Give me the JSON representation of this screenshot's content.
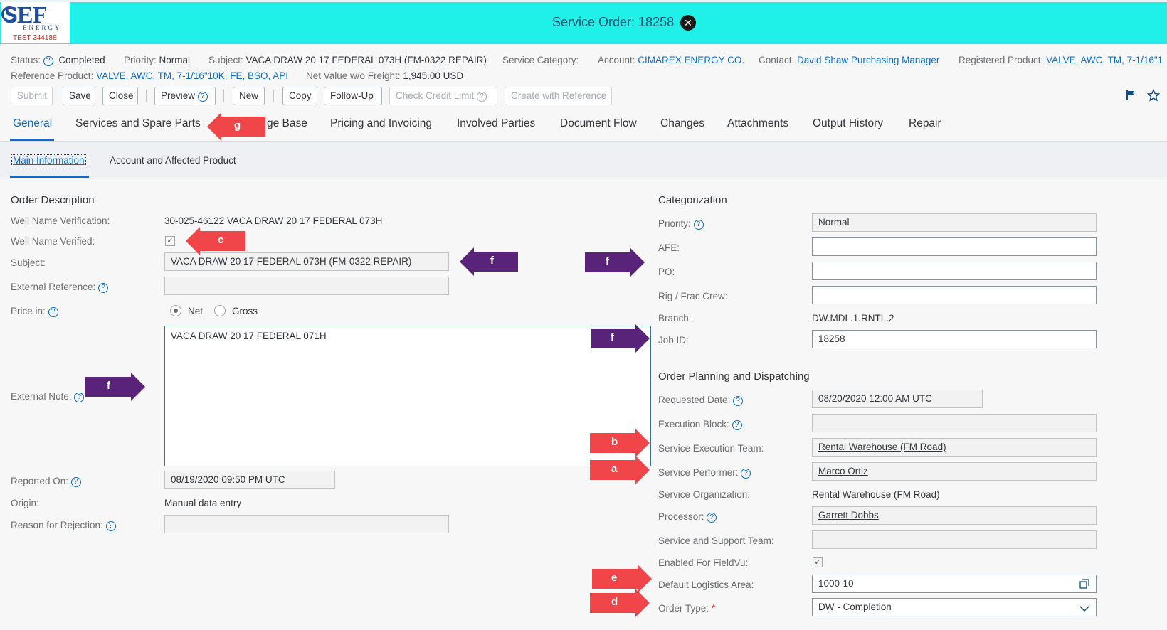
{
  "header": {
    "title": "Service Order: 18258",
    "logo": {
      "main": "SEF",
      "sub": "ENERGY",
      "test": "TEST 344188"
    }
  },
  "info": {
    "status_label": "Status:",
    "status_value": "Completed",
    "priority_label": "Priority:",
    "priority_value": "Normal",
    "subject_label": "Subject:",
    "subject_value": "VACA DRAW 20 17 FEDERAL 073H (FM-0322 REPAIR)",
    "service_category_label": "Service Category:",
    "account_label": "Account:",
    "account_value": "CIMAREX ENERGY CO.",
    "contact_label": "Contact:",
    "contact_value": "David Shaw Purchasing Manager",
    "registered_label": "Registered Product:",
    "registered_value": "VALVE, AWC, TM, 7-1/16\"1",
    "reference_label": "Reference Product:",
    "reference_value": "VALVE, AWC, TM, 7-1/16\"10K, FE, BSO, API",
    "net_label": "Net Value w/o Freight:",
    "net_value": "1,945.00 USD"
  },
  "toolbar": {
    "submit": "Submit",
    "save": "Save",
    "close": "Close",
    "preview": "Preview",
    "new": "New",
    "copy": "Copy",
    "follow_up": "Follow-Up",
    "check_credit": "Check Credit Limit",
    "create_ref": "Create with Reference"
  },
  "tabs": {
    "general": "General",
    "services": "Services and Spare Parts",
    "knowledge": "ge Base",
    "pricing": "Pricing and Invoicing",
    "parties": "Involved Parties",
    "docflow": "Document Flow",
    "changes": "Changes",
    "attachments": "Attachments",
    "output": "Output History",
    "repair": "Repair"
  },
  "subtabs": {
    "main": "Main Information",
    "account": "Account and Affected Product"
  },
  "left": {
    "section": "Order Description",
    "well_verification_label": "Well Name Verification:",
    "well_verification_value": "30-025-46122 VACA DRAW 20 17 FEDERAL 073H",
    "well_verified_label": "Well Name Verified:",
    "subject_label": "Subject:",
    "subject_value": "VACA DRAW 20 17 FEDERAL 073H (FM-0322 REPAIR)",
    "external_ref_label": "External Reference:",
    "price_in_label": "Price in:",
    "net": "Net",
    "gross": "Gross",
    "external_note_label": "External Note:",
    "external_note_value": "VACA DRAW 20 17 FEDERAL 071H",
    "reported_on_label": "Reported On:",
    "reported_on_value": "08/19/2020 09:50 PM UTC",
    "origin_label": "Origin:",
    "origin_value": "Manual data entry",
    "rejection_label": "Reason for Rejection:"
  },
  "right": {
    "categorization": "Categorization",
    "priority_label": "Priority:",
    "priority_value": "Normal",
    "afe_label": "AFE:",
    "po_label": "PO:",
    "rig_label": "Rig / Frac Crew:",
    "branch_label": "Branch:",
    "branch_value": "DW.MDL.1.RNTL.2",
    "job_label": "Job ID:",
    "job_value": "18258",
    "planning": "Order Planning and Dispatching",
    "requested_label": "Requested Date:",
    "requested_value": "08/20/2020 12:00 AM UTC",
    "exec_block_label": "Execution Block:",
    "exec_team_label": "Service Execution Team:",
    "exec_team_value": "Rental Warehouse (FM Road)",
    "performer_label": "Service Performer:",
    "performer_value": "Marco Ortiz",
    "org_label": "Service Organization:",
    "org_value": "Rental Warehouse (FM Road)",
    "processor_label": "Processor:",
    "processor_value": "Garrett Dobbs",
    "support_label": "Service and Support Team:",
    "fieldvu_label": "Enabled For FieldVu:",
    "logistics_label": "Default Logistics Area:",
    "logistics_value": "1000-10",
    "order_type_label": "Order Type:",
    "order_type_value": "DW - Completion"
  },
  "callouts": {
    "a": "a",
    "b": "b",
    "c": "c",
    "d": "d",
    "e": "e",
    "f": "f",
    "g": "g"
  },
  "colors": {
    "header": "#1ff0e8",
    "red_arrow": "#f0464a",
    "purple_arrow": "#5a237a",
    "link": "#0a6ed1"
  }
}
